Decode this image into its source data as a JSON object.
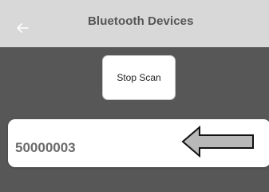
{
  "header": {
    "title": "Bluetooth Devices",
    "back_icon": "arrow-left-icon"
  },
  "controls": {
    "scan_button_label": "Stop Scan"
  },
  "devices": [
    {
      "name": "50000003"
    }
  ],
  "annotation": {
    "icon": "left-arrow-indicator-icon",
    "fill_color": "#b8b8b8",
    "stroke_color": "#111111"
  },
  "colors": {
    "app_bar": "#d8d8d8",
    "background": "#555555",
    "card": "#ffffff"
  }
}
